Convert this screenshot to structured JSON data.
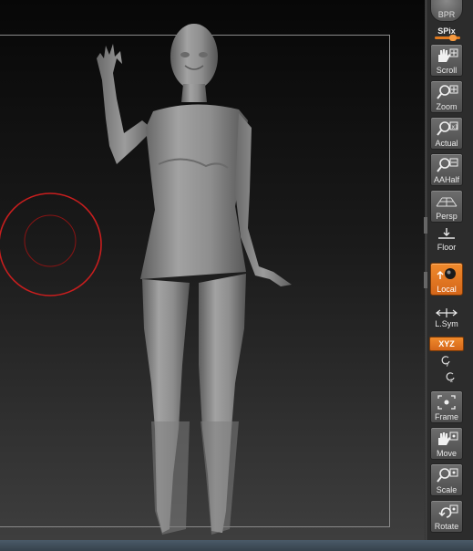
{
  "shelf": {
    "bpr_label": "BPR",
    "spix_label": "SPix",
    "scroll_label": "Scroll",
    "zoom_label": "Zoom",
    "actual_label": "Actual",
    "aahalf_label": "AAHalf",
    "persp_label": "Persp",
    "floor_label": "Floor",
    "local_label": "Local",
    "lsym_label": "L.Sym",
    "xyz_label": "XYZ",
    "frame_label": "Frame",
    "move_label": "Move",
    "scale_label": "Scale",
    "rotate_label": "Rotate"
  },
  "colors": {
    "accent": "#e07a20",
    "brush_cursor": "#c81e1e",
    "model": "#8c8c8c"
  },
  "icons": {
    "scroll": "hand-scroll-icon",
    "zoom": "magnifier-icon",
    "actual": "magnifier-1to1-icon",
    "aahalf": "magnifier-half-icon",
    "persp": "perspective-grid-icon",
    "floor": "floor-icon",
    "local": "local-transform-icon",
    "lsym": "local-symmetry-icon",
    "frame": "frame-icon",
    "move": "hand-move-icon",
    "scale": "magnifier-scale-icon",
    "rotate": "rotate-icon"
  }
}
